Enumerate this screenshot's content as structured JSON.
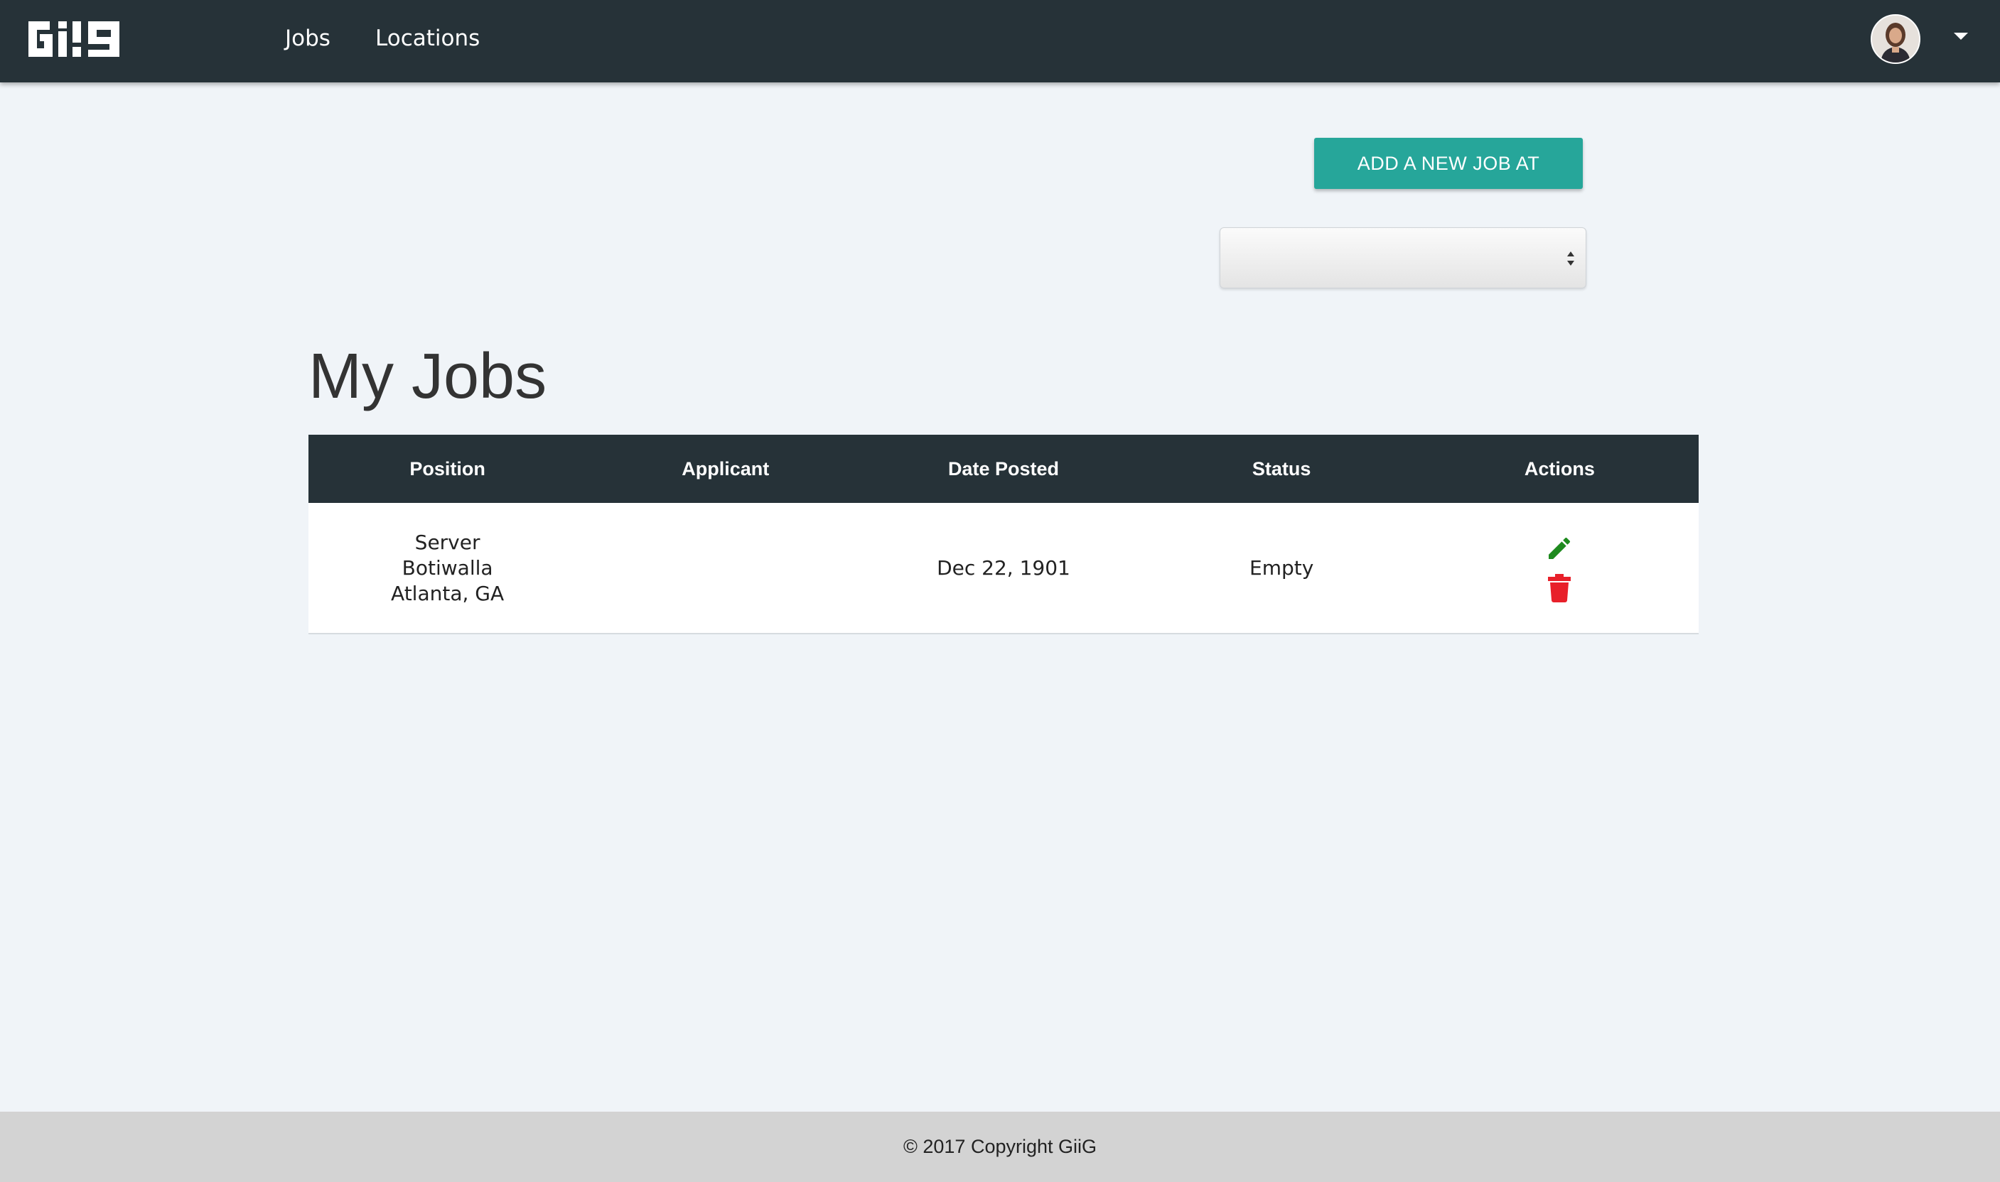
{
  "nav": {
    "brand_logo": "GiiG",
    "links": [
      {
        "label": "Jobs"
      },
      {
        "label": "Locations"
      }
    ],
    "user_menu_icon": "chevron-down-icon"
  },
  "actions": {
    "add_job_label": "ADD A NEW JOB AT",
    "location_select_value": ""
  },
  "page": {
    "title": "My Jobs"
  },
  "table": {
    "headers": [
      "Position",
      "Applicant",
      "Date Posted",
      "Status",
      "Actions"
    ],
    "rows": [
      {
        "position": [
          "Server",
          "Botiwalla",
          "Atlanta, GA"
        ],
        "applicant": "",
        "date_posted": "Dec 22, 1901",
        "status": "Empty",
        "actions": [
          "pencil-icon",
          "trash-icon"
        ]
      }
    ]
  },
  "footer": {
    "copyright": "© 2017 Copyright GiiG"
  },
  "colors": {
    "navbar": "#263238",
    "accent": "#26a69a",
    "edit": "#1e8a1e",
    "delete": "#e8202a",
    "background": "#f0f4f8",
    "footer": "#d3d3d3"
  }
}
